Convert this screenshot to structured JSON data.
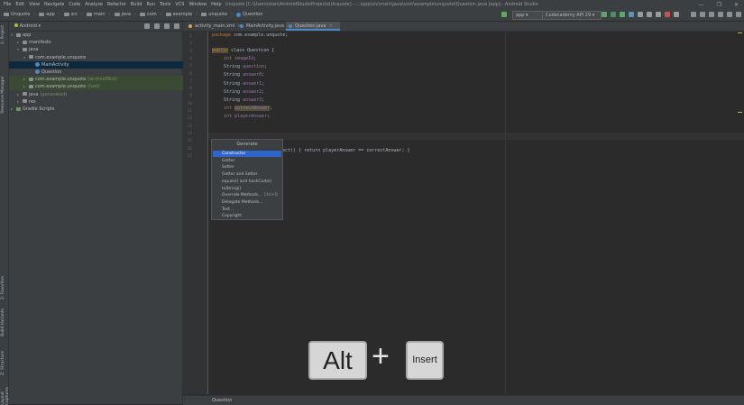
{
  "window": {
    "title": "Unquote [C:\\Users\\stan\\AndroidStudioProjects\\Unquote] - ...\\app\\src\\main\\java\\com\\example\\unquote\\Question.java [app] - Android Studio",
    "menu": [
      "File",
      "Edit",
      "View",
      "Navigate",
      "Code",
      "Analyze",
      "Refactor",
      "Build",
      "Run",
      "Tools",
      "VCS",
      "Window",
      "Help"
    ],
    "controls": [
      "—",
      "❐",
      "✕"
    ]
  },
  "navbar": {
    "breadcrumbs": [
      "Unquote",
      "app",
      "src",
      "main",
      "java",
      "com",
      "example",
      "unquote",
      "Question"
    ],
    "run_config": "app",
    "device": "Codecademy API 29"
  },
  "left_tools": [
    "1: Project",
    "Resource Manager",
    "2: Favorites",
    "Build Variants",
    "Z: Structure",
    "Layout Captures"
  ],
  "project": {
    "view_mode": "Android",
    "tree": [
      {
        "label": "app",
        "hint": "",
        "indent": 0,
        "arrow": "▾",
        "icon": "folder"
      },
      {
        "label": "manifests",
        "hint": "",
        "indent": 1,
        "arrow": "▸",
        "icon": "folder"
      },
      {
        "label": "java",
        "hint": "",
        "indent": 1,
        "arrow": "▾",
        "icon": "folder"
      },
      {
        "label": "com.example.unquote",
        "hint": "",
        "indent": 2,
        "arrow": "▾",
        "icon": "package"
      },
      {
        "label": "MainActivity",
        "hint": "",
        "indent": 3,
        "arrow": "",
        "icon": "class",
        "selected": true
      },
      {
        "label": "Question",
        "hint": "",
        "indent": 3,
        "arrow": "",
        "icon": "class"
      },
      {
        "label": "com.example.unquote",
        "hint": "(androidTest)",
        "indent": 2,
        "arrow": "▸",
        "icon": "package",
        "tinted": true
      },
      {
        "label": "com.example.unquote",
        "hint": "(test)",
        "indent": 2,
        "arrow": "▸",
        "icon": "package",
        "tinted": true
      },
      {
        "label": "java",
        "hint": "(generated)",
        "indent": 1,
        "arrow": "▸",
        "icon": "folder"
      },
      {
        "label": "res",
        "hint": "",
        "indent": 1,
        "arrow": "▸",
        "icon": "folder"
      },
      {
        "label": "Gradle Scripts",
        "hint": "",
        "indent": 0,
        "arrow": "▸",
        "icon": "gradle"
      }
    ]
  },
  "tabs": [
    {
      "label": "activity_main.xml",
      "active": false,
      "color": "#e8a33d"
    },
    {
      "label": "MainActivity.java",
      "active": false,
      "color": "#4a88c7"
    },
    {
      "label": "Question.java",
      "active": true,
      "color": "#4a88c7"
    }
  ],
  "editor": {
    "line_numbers": [
      "1",
      "2",
      "3",
      "4",
      "5",
      "6",
      "7",
      "8",
      "9",
      "10",
      "11",
      "12",
      "13",
      "14",
      "15",
      "16",
      "17"
    ],
    "package_line": "package com.example.unquote;",
    "class_line": [
      "public",
      " class Question {"
    ],
    "fields": [
      {
        "type": "int",
        "name": "imageId"
      },
      {
        "type": "String",
        "name": "question"
      },
      {
        "type": "String",
        "name": "answer0"
      },
      {
        "type": "String",
        "name": "answer1"
      },
      {
        "type": "String",
        "name": "answer2"
      },
      {
        "type": "String",
        "name": "answer3"
      },
      {
        "type": "int",
        "name": "correctAnswer"
      },
      {
        "type": "int",
        "name": "playerAnswer"
      }
    ],
    "method_line_visible": "rect() { return playerAnswer == correctAnswer; }"
  },
  "generate_popup": {
    "title": "Generate",
    "items": [
      {
        "label": "Constructor",
        "shortcut": "",
        "selected": true
      },
      {
        "label": "Getter",
        "shortcut": ""
      },
      {
        "label": "Setter",
        "shortcut": ""
      },
      {
        "label": "Getter and Setter",
        "shortcut": ""
      },
      {
        "label": "equals() and hashCode()",
        "shortcut": ""
      },
      {
        "label": "toString()",
        "shortcut": ""
      },
      {
        "label": "Override Methods...",
        "shortcut": "Ctrl+O"
      },
      {
        "label": "Delegate Methods...",
        "shortcut": ""
      },
      {
        "label": "Test...",
        "shortcut": ""
      },
      {
        "label": "Copyright",
        "shortcut": ""
      }
    ]
  },
  "keys": {
    "first": "Alt",
    "plus": "+",
    "second": "Insert"
  },
  "status": {
    "breadcrumb": "Question"
  },
  "colors": {
    "accent": "#4a88c7",
    "selection": "#2f65ca",
    "keyword": "#cc7832",
    "field": "#9876aa"
  }
}
